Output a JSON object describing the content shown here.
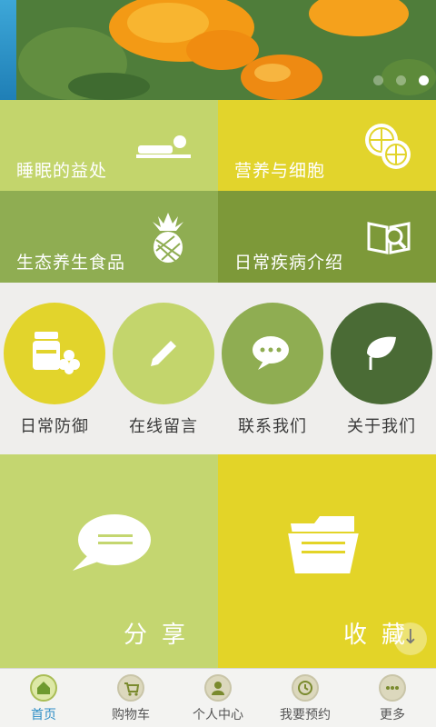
{
  "banner": {
    "slides": 3,
    "active_slide": 3
  },
  "tiles": [
    {
      "label": "睡眠的益处",
      "icon": "sleeping-person-icon"
    },
    {
      "label": "营养与细胞",
      "icon": "lemon-slices-icon"
    },
    {
      "label": "生态养生食品",
      "icon": "pineapple-icon"
    },
    {
      "label": "日常疾病介绍",
      "icon": "book-magnifier-icon"
    }
  ],
  "circles": [
    {
      "label": "日常防御",
      "icon": "supplement-jar-icon",
      "color": "#e2d42c"
    },
    {
      "label": "在线留言",
      "icon": "pencil-icon",
      "color": "#c3d56c"
    },
    {
      "label": "联系我们",
      "icon": "chat-bubble-icon",
      "color": "#8fad52"
    },
    {
      "label": "关于我们",
      "icon": "leaf-icon",
      "color": "#4a6b35"
    }
  ],
  "big_tiles": {
    "share_label": "分享",
    "favorite_label": "收藏"
  },
  "nav": [
    {
      "label": "首页",
      "icon": "home-icon",
      "active": true
    },
    {
      "label": "购物车",
      "icon": "cart-icon",
      "active": false
    },
    {
      "label": "个人中心",
      "icon": "user-icon",
      "active": false
    },
    {
      "label": "我要预约",
      "icon": "clock-icon",
      "active": false
    },
    {
      "label": "更多",
      "icon": "more-icon",
      "active": false
    }
  ],
  "colors": {
    "accent": "#2f8ec6"
  }
}
